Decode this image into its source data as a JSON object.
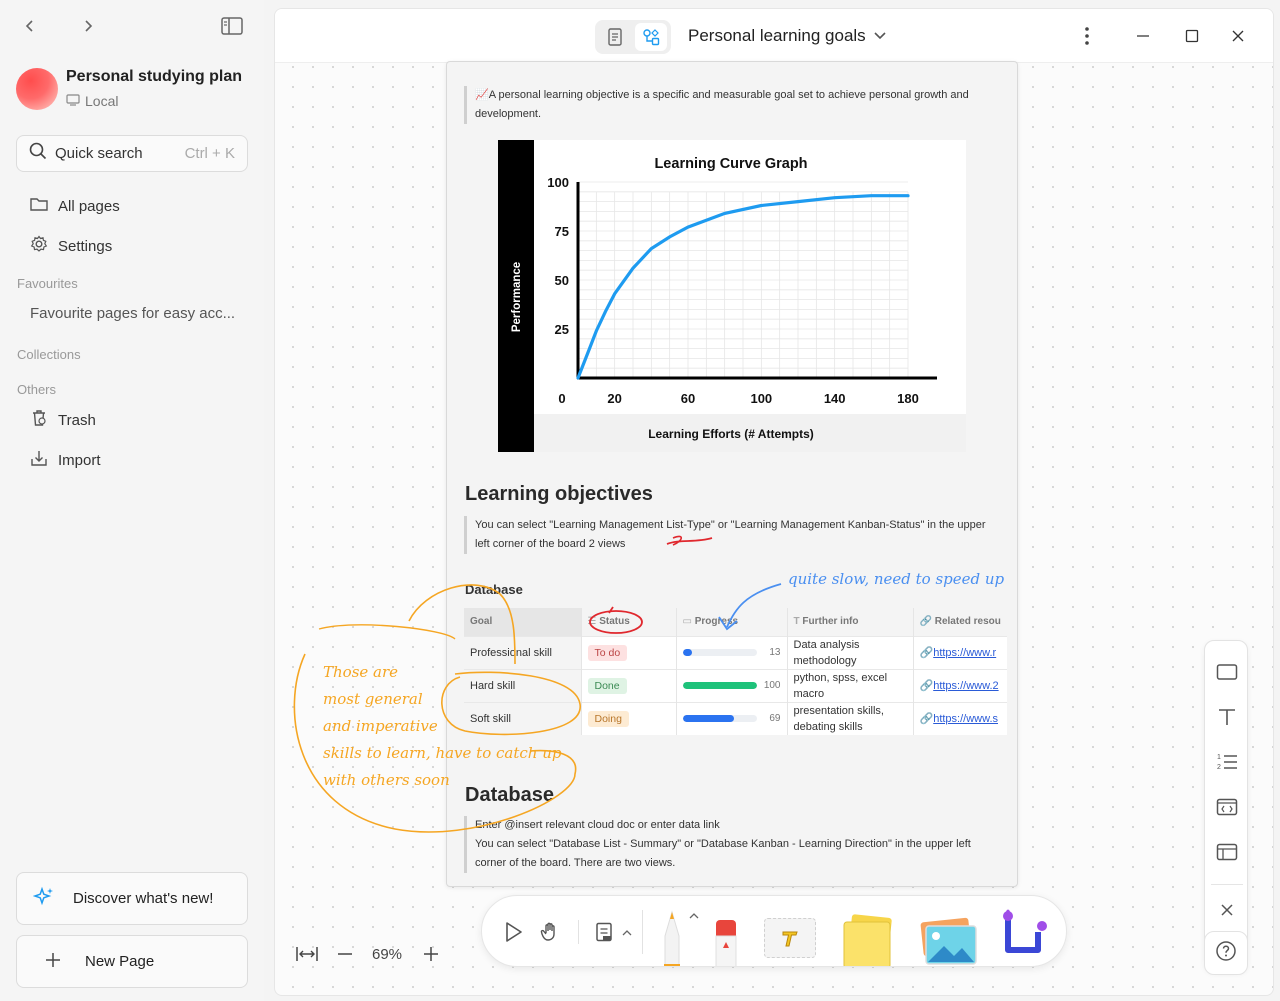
{
  "sidebar": {
    "workspace_name": "Personal studying plan",
    "workspace_type": "Local",
    "search_label": "Quick search",
    "search_shortcut": "Ctrl + K",
    "all_pages": "All pages",
    "settings": "Settings",
    "favourites_heading": "Favourites",
    "favourites_placeholder": "Favourite pages for easy acc...",
    "collections_heading": "Collections",
    "others_heading": "Others",
    "trash": "Trash",
    "import": "Import",
    "discover": "Discover what's new!",
    "new_page": "New Page"
  },
  "topbar": {
    "title": "Personal learning goals"
  },
  "doc": {
    "intro_emoji": "📈",
    "intro": "A personal learning objective is a specific and measurable goal set to achieve personal growth and development.",
    "objectives_heading": "Learning objectives",
    "objectives_note": "You can select \"Learning Management List-Type\" or \"Learning Management Kanban-Status\" in the upper left corner of the board 2 views",
    "database_label": "Database",
    "database_heading": "Database",
    "database_note_1": "Enter @insert relevant cloud doc or enter data link",
    "database_note_2": "You can select \"Database List - Summary\" or \"Database Kanban - Learning Direction\" in the upper left corner of the board. There are two views."
  },
  "table": {
    "headers": [
      "Goal",
      "Status",
      "Progress",
      "Further info",
      "Related resou"
    ],
    "rows": [
      {
        "goal": "Professional skill",
        "status": "To do",
        "progress": 13,
        "progress_label": "13",
        "info_1": "Data analysis",
        "info_2": "methodology",
        "link": "https://www.r"
      },
      {
        "goal": "Hard skill",
        "status": "Done",
        "progress": 100,
        "progress_label": "100",
        "info_1": "python, spss, excel",
        "info_2": "macro",
        "link": "https://www.2"
      },
      {
        "goal": "Soft skill",
        "status": "Doing",
        "progress": 69,
        "progress_label": "69",
        "info_1": "presentation skills,",
        "info_2": "debating skills",
        "link": "https://www.s"
      }
    ]
  },
  "annotations": {
    "blue": "quite slow, need to speed up",
    "orange_1": "Those are",
    "orange_2": "most general",
    "orange_3": "and imperative",
    "orange_4": "skills to learn, have to catch up",
    "orange_5": "with others soon"
  },
  "zoom": {
    "level": "69%"
  },
  "colors": {
    "accent_blue": "#1e9bf0",
    "annotation_orange": "#f5a623",
    "annotation_blue": "#4a8ff0",
    "annotation_red": "#e0282e",
    "todo_bg": "#fde1e1",
    "done_bg": "#dff3e4",
    "doing_bg": "#fdebd3",
    "progress_low": "#2b73f0",
    "progress_done": "#1ec27a"
  },
  "chart_data": {
    "type": "line",
    "title": "Learning Curve Graph",
    "xlabel": "Learning Efforts (# Attempts)",
    "ylabel": "Performance",
    "x_ticks": [
      "20",
      "60",
      "100",
      "140",
      "180"
    ],
    "y_ticks": [
      "100",
      "75",
      "50",
      "25"
    ],
    "origin_label": "0",
    "xlim": [
      0,
      180
    ],
    "ylim": [
      0,
      100
    ],
    "grid": true,
    "series": [
      {
        "values": [
          [
            0,
            0
          ],
          [
            5,
            12
          ],
          [
            10,
            24
          ],
          [
            15,
            34
          ],
          [
            20,
            43
          ],
          [
            30,
            56
          ],
          [
            40,
            66
          ],
          [
            50,
            72
          ],
          [
            60,
            77
          ],
          [
            80,
            84
          ],
          [
            100,
            88
          ],
          [
            120,
            90
          ],
          [
            140,
            92
          ],
          [
            160,
            93
          ],
          [
            180,
            93
          ]
        ]
      }
    ]
  }
}
